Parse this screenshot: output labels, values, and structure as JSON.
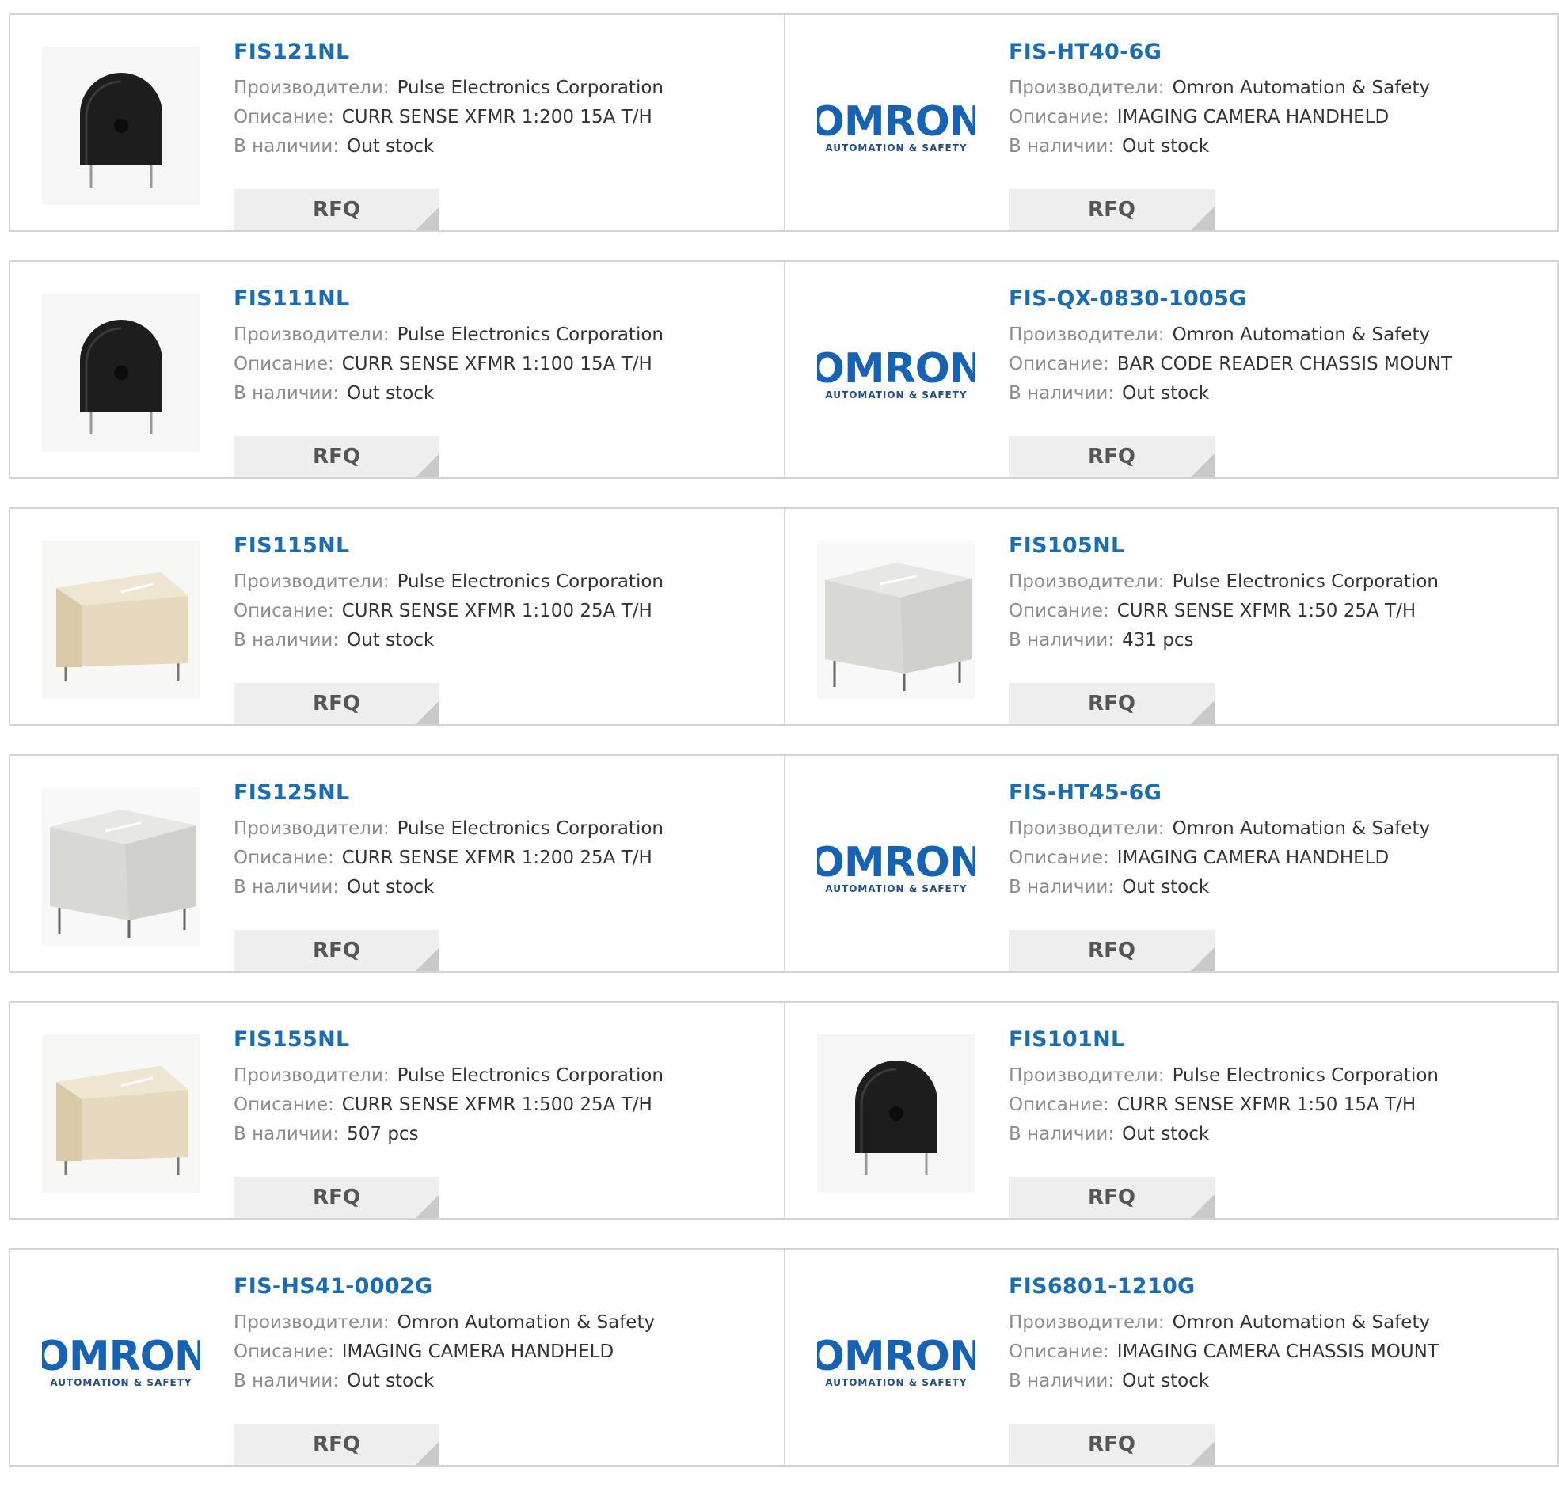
{
  "labels": {
    "manufacturer": "Производители:",
    "description": "Описание:",
    "stock": "В наличии:",
    "rfq": "RFQ"
  },
  "logo": {
    "brand": "OMRON",
    "tagline": "AUTOMATION & SAFETY"
  },
  "colors": {
    "part_link": "#1a6db5",
    "omron_blue": "#1662b5",
    "rfq_bg": "#eeeeee"
  },
  "products": [
    {
      "part": "FIS121NL",
      "manufacturer": "Pulse Electronics Corporation",
      "description": "CURR SENSE XFMR 1:200 15A T/H",
      "stock": "Out stock",
      "image": "black-transformer"
    },
    {
      "part": "FIS-HT40-6G",
      "manufacturer": "Omron Automation & Safety",
      "description": "IMAGING CAMERA HANDHELD",
      "stock": "Out stock",
      "image": "omron-logo"
    },
    {
      "part": "FIS111NL",
      "manufacturer": "Pulse Electronics Corporation",
      "description": "CURR SENSE XFMR 1:100 15A T/H",
      "stock": "Out stock",
      "image": "black-transformer"
    },
    {
      "part": "FIS-QX-0830-1005G",
      "manufacturer": "Omron Automation & Safety",
      "description": "BAR CODE READER CHASSIS MOUNT",
      "stock": "Out stock",
      "image": "omron-logo"
    },
    {
      "part": "FIS115NL",
      "manufacturer": "Pulse Electronics Corporation",
      "description": "CURR SENSE XFMR 1:100 25A T/H",
      "stock": "Out stock",
      "image": "beige-transformer"
    },
    {
      "part": "FIS105NL",
      "manufacturer": "Pulse Electronics Corporation",
      "description": "CURR SENSE XFMR 1:50 25A T/H",
      "stock": "431 pcs",
      "image": "grey-transformer"
    },
    {
      "part": "FIS125NL",
      "manufacturer": "Pulse Electronics Corporation",
      "description": "CURR SENSE XFMR 1:200 25A T/H",
      "stock": "Out stock",
      "image": "grey-transformer"
    },
    {
      "part": "FIS-HT45-6G",
      "manufacturer": "Omron Automation & Safety",
      "description": "IMAGING CAMERA HANDHELD",
      "stock": "Out stock",
      "image": "omron-logo"
    },
    {
      "part": "FIS155NL",
      "manufacturer": "Pulse Electronics Corporation",
      "description": "CURR SENSE XFMR 1:500 25A T/H",
      "stock": "507 pcs",
      "image": "beige-transformer"
    },
    {
      "part": "FIS101NL",
      "manufacturer": "Pulse Electronics Corporation",
      "description": "CURR SENSE XFMR 1:50 15A T/H",
      "stock": "Out stock",
      "image": "black-transformer"
    },
    {
      "part": "FIS-HS41-0002G",
      "manufacturer": "Omron Automation & Safety",
      "description": "IMAGING CAMERA HANDHELD",
      "stock": "Out stock",
      "image": "omron-logo"
    },
    {
      "part": "FIS6801-1210G",
      "manufacturer": "Omron Automation & Safety",
      "description": "IMAGING CAMERA CHASSIS MOUNT",
      "stock": "Out stock",
      "image": "omron-logo"
    }
  ]
}
